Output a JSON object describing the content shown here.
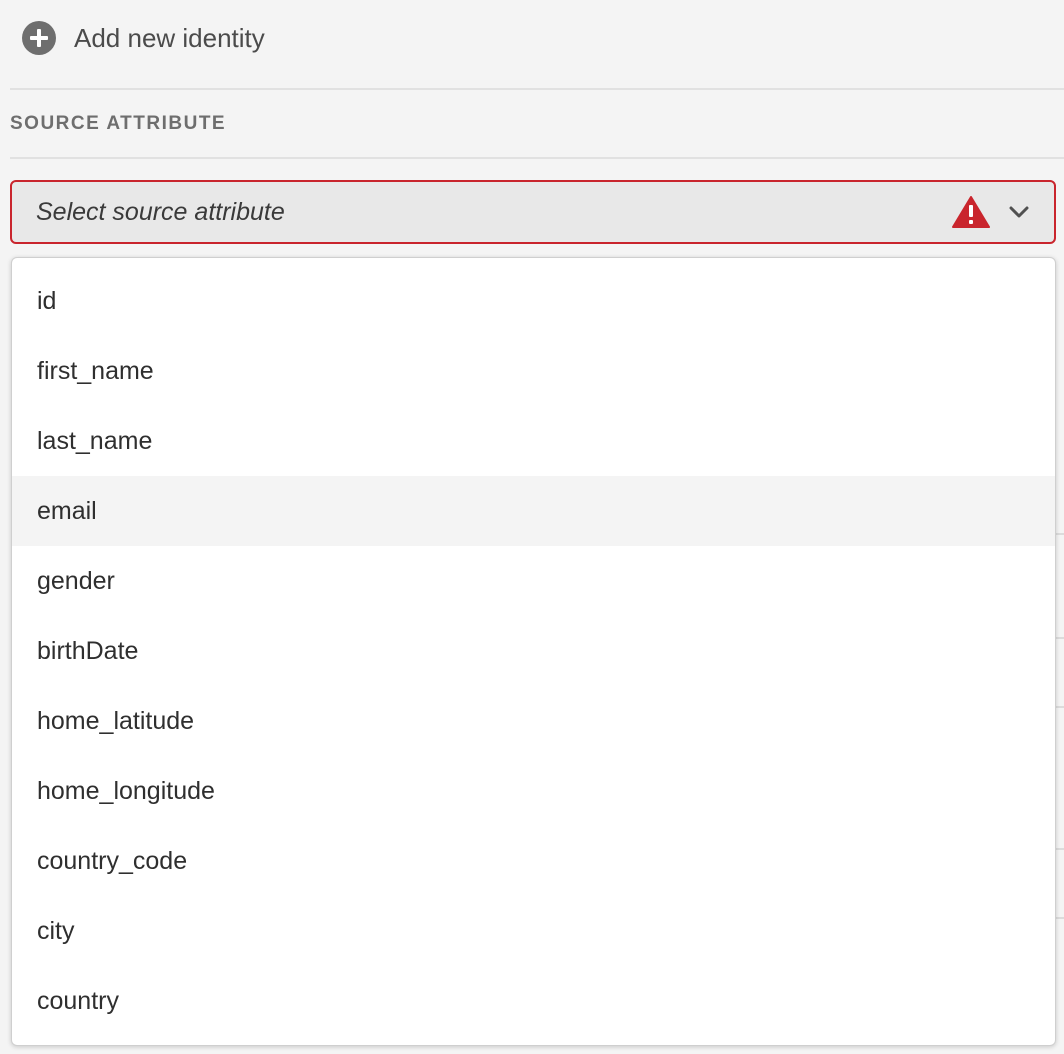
{
  "add_identity": {
    "label": "Add new identity",
    "icon": "plus-circle-icon"
  },
  "section": {
    "title": "SOURCE ATTRIBUTE"
  },
  "picker": {
    "placeholder": "Select source attribute",
    "state": "invalid",
    "alert_icon": "alert-triangle-icon",
    "chevron_icon": "chevron-down-icon",
    "error_color": "#c9252d"
  },
  "menu": {
    "hovered_index": 3,
    "items": [
      {
        "label": "id"
      },
      {
        "label": "first_name"
      },
      {
        "label": "last_name"
      },
      {
        "label": "email"
      },
      {
        "label": "gender"
      },
      {
        "label": "birthDate"
      },
      {
        "label": "home_latitude"
      },
      {
        "label": "home_longitude"
      },
      {
        "label": "country_code"
      },
      {
        "label": "city"
      },
      {
        "label": "country"
      }
    ]
  }
}
